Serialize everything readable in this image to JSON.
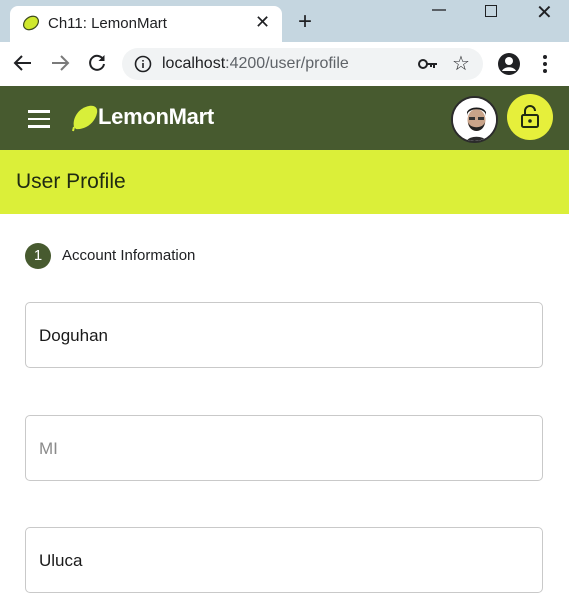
{
  "browser": {
    "tab_title": "Ch11: LemonMart",
    "url_host": "localhost",
    "url_path": ":4200/user/profile"
  },
  "app": {
    "brand": "LemonMart",
    "page_title": "User Profile",
    "colors": {
      "appbar": "#475a2f",
      "accent": "#dbef39",
      "lock_button": "#e6ef3b"
    }
  },
  "form": {
    "step_number": "1",
    "step_label": "Account Information",
    "fields": [
      {
        "value": "Doguhan",
        "placeholder": ""
      },
      {
        "value": "",
        "placeholder": "MI"
      },
      {
        "value": "Uluca",
        "placeholder": ""
      }
    ]
  }
}
